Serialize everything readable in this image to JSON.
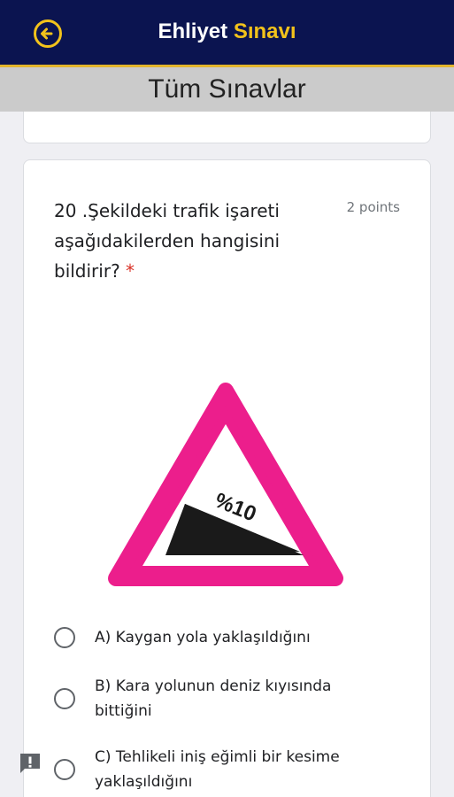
{
  "appbar": {
    "title_part1": "Ehliyet",
    "title_part2": "Sınavı",
    "back_icon": "arrow-left-circle-icon",
    "accent_color": "#f2c21b",
    "background_color": "#0b1450"
  },
  "subbar": {
    "title": "Tüm Sınavlar"
  },
  "question": {
    "text": "20 .Şekildeki trafik işareti aşağıdakilerden hangisini bildirir?",
    "required_marker": "*",
    "points": "2 points",
    "image": {
      "sign_type": "steep-descent-warning",
      "sign_text": "%10",
      "border_color": "#ec1e8c"
    },
    "options": [
      {
        "label": "A) Kaygan yola yaklaşıldığını",
        "selected": false
      },
      {
        "label": "B) Kara yolunun deniz kıyısında bittiğini",
        "selected": false
      },
      {
        "label": "C) Tehlikeli iniş eğimli bir kesime yaklaşıldığını",
        "selected": false
      }
    ]
  },
  "feedback_icon": "report-feedback-icon"
}
